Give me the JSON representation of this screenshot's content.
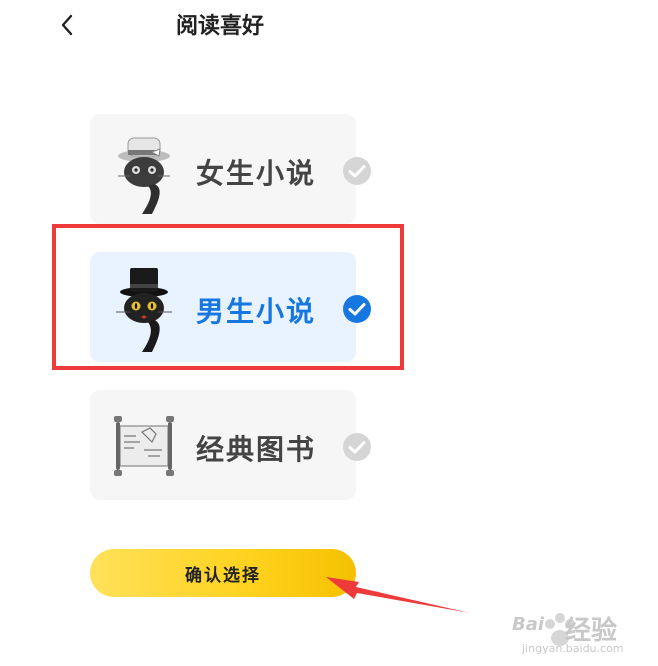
{
  "header": {
    "title": "阅读喜好",
    "back_icon": "chevron-left-icon"
  },
  "options": [
    {
      "label": "女生小说",
      "selected": false,
      "icon": "cat-with-boater-hat-icon"
    },
    {
      "label": "男生小说",
      "selected": true,
      "icon": "cat-with-top-hat-icon"
    },
    {
      "label": "经典图书",
      "selected": false,
      "icon": "ancient-scroll-icon"
    }
  ],
  "confirm": {
    "label": "确认选择"
  },
  "colors": {
    "accent": "#1677e0",
    "check_inactive": "#d5d5d5",
    "button_yellow": "#ffd21e",
    "highlight_red": "#ee3a3a"
  },
  "watermark": {
    "brand": "Bai",
    "suffix": "经验",
    "url": "jingyan.baidu.com"
  }
}
